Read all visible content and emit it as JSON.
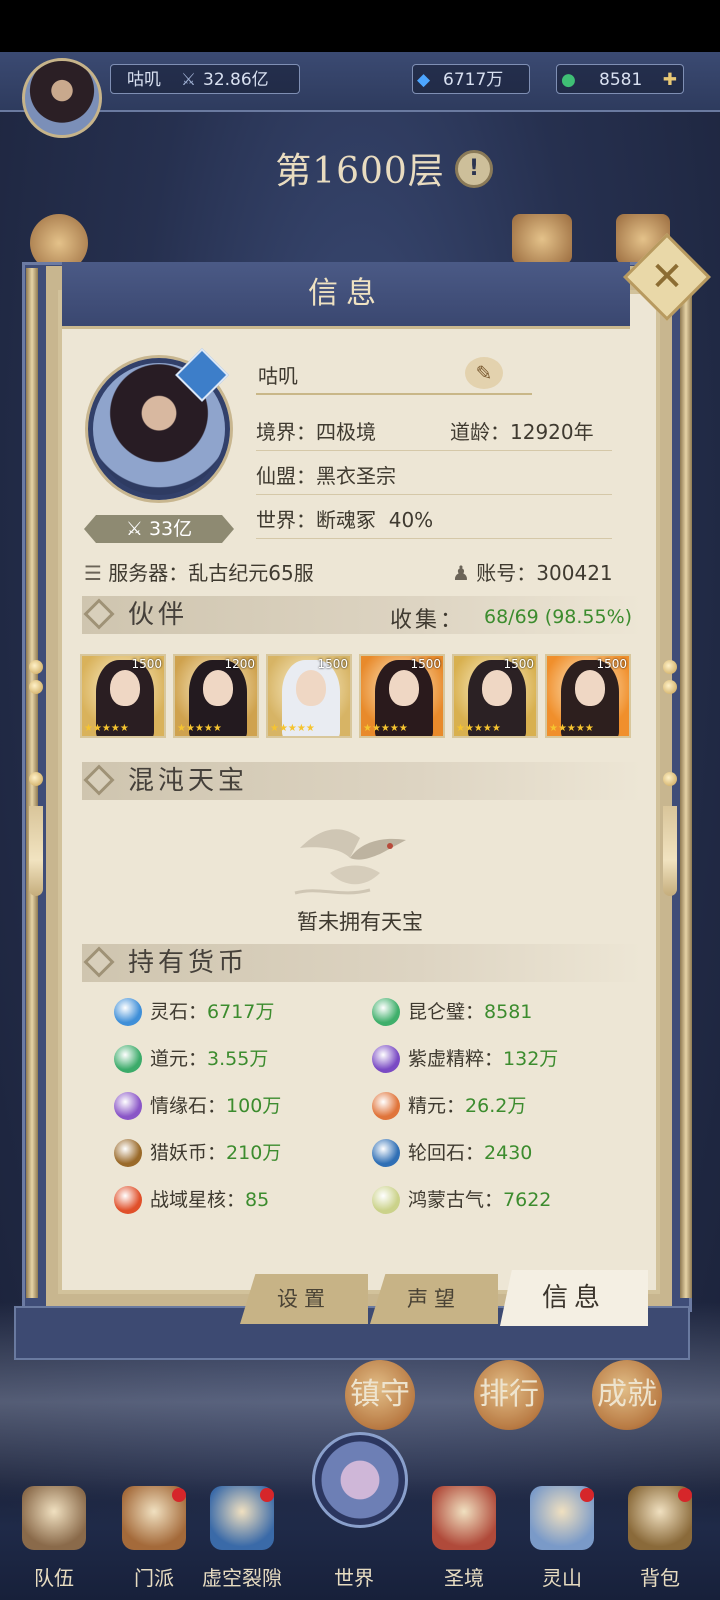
{
  "header": {
    "player_name": "咕叽",
    "combat_power": "32.86亿",
    "spirit_stone": "6717万",
    "jade": "8581"
  },
  "floor": {
    "title": "第1600层",
    "info_icon": "!"
  },
  "dialog": {
    "title": "信息",
    "close_icon": "close-icon"
  },
  "profile": {
    "name": "咕叽",
    "power_badge": "33亿",
    "realm_label": "境界：",
    "realm": "四极境",
    "dao_age_label": "道龄：",
    "dao_age": "12920年",
    "alliance_label": "仙盟：",
    "alliance": "黑衣圣宗",
    "world_label": "世界：",
    "world": "断魂冢",
    "world_progress": "40%",
    "server_label": "服务器：",
    "server": "乱古纪元65服",
    "account_label": "账号：",
    "account": "300421"
  },
  "partners": {
    "section_title": "伙伴",
    "collect_label": "收集：",
    "collect_value": "68/69 (98.55%)",
    "cards": [
      {
        "level": "1500",
        "hair": "#2a1e22",
        "bg": "#d9b25b"
      },
      {
        "level": "1200",
        "hair": "#231a1f",
        "bg": "#cfa24e"
      },
      {
        "level": "1500",
        "hair": "#e9ecf2",
        "bg": "#d7b465"
      },
      {
        "level": "1500",
        "hair": "#2a1a1c",
        "bg": "#e88a2b"
      },
      {
        "level": "1500",
        "hair": "#2b2124",
        "bg": "#d8b04f"
      },
      {
        "level": "1500",
        "hair": "#2d1f1e",
        "bg": "#f08f2c"
      }
    ]
  },
  "treasure": {
    "section_title": "混沌天宝",
    "empty_text": "暂未拥有天宝"
  },
  "currency": {
    "section_title": "持有货币",
    "items": [
      {
        "label": "灵石：",
        "value": "6717万",
        "icon": "spirit-stone-icon",
        "color": "#3f8fd8"
      },
      {
        "label": "昆仑璧：",
        "value": "8581",
        "icon": "kunlun-jade-icon",
        "color": "#3faf6b"
      },
      {
        "label": "道元：",
        "value": "3.55万",
        "icon": "dao-yuan-icon",
        "color": "#3cab6a"
      },
      {
        "label": "紫虚精粹：",
        "value": "132万",
        "icon": "purple-essence-icon",
        "color": "#7a4bc4"
      },
      {
        "label": "情缘石：",
        "value": "100万",
        "icon": "fate-stone-icon",
        "color": "#8a56c7"
      },
      {
        "label": "精元：",
        "value": "26.2万",
        "icon": "essence-icon",
        "color": "#e0743a"
      },
      {
        "label": "猎妖币：",
        "value": "210万",
        "icon": "demon-coin-icon",
        "color": "#9a6a2a"
      },
      {
        "label": "轮回石：",
        "value": "2430",
        "icon": "reincarnation-stone-icon",
        "color": "#2f6fb5"
      },
      {
        "label": "战域星核：",
        "value": "85",
        "icon": "star-core-icon",
        "color": "#e0502a"
      },
      {
        "label": "鸿蒙古气：",
        "value": "7622",
        "icon": "primordial-qi-icon",
        "color": "#cbd28a"
      }
    ]
  },
  "tabs": {
    "settings": "设置",
    "reputation": "声望",
    "info": "信息"
  },
  "side_buttons": {
    "guard": "镇守",
    "rank": "排行",
    "achievement": "成就"
  },
  "nav": [
    {
      "label": "队伍",
      "color": "#8a6a4a",
      "dot": false
    },
    {
      "label": "门派",
      "color": "#a46a3a",
      "dot": true
    },
    {
      "label": "虚空裂隙",
      "color": "#3a6aa8",
      "dot": true
    },
    {
      "label": "世界",
      "color": "#6d7fb5",
      "dot": false
    },
    {
      "label": "圣境",
      "color": "#b04a3a",
      "dot": false
    },
    {
      "label": "灵山",
      "color": "#7a9ac8",
      "dot": true
    },
    {
      "label": "背包",
      "color": "#8a6a3a",
      "dot": true
    }
  ]
}
